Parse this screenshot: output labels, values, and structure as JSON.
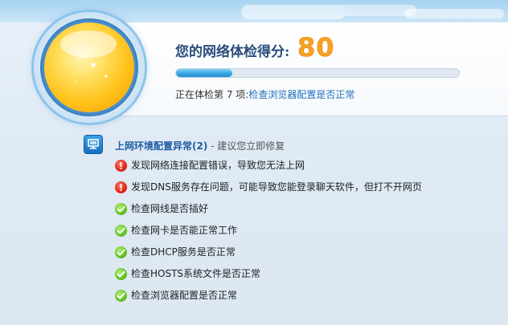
{
  "header": {
    "score_title": "您的网络体检得分:",
    "score_value": "80",
    "progress_percent": 20,
    "status_prefix": "正在体检第 7 项:",
    "status_link": "检查浏览器配置是否正常"
  },
  "section": {
    "icon": "computer-monitor-icon",
    "title": "上网环境配置异常(2)",
    "suggestion": "- 建议您立即修复"
  },
  "items": [
    {
      "status": "error",
      "icon": "error-exclamation-icon",
      "text": "发现网络连接配置错误，导致您无法上网"
    },
    {
      "status": "error",
      "icon": "error-exclamation-icon",
      "text": "发现DNS服务存在问题，可能导致您能登录聊天软件，但打不开网页"
    },
    {
      "status": "ok",
      "icon": "check-icon",
      "text": "检查网线是否插好"
    },
    {
      "status": "ok",
      "icon": "check-icon",
      "text": "检查网卡是否能正常工作"
    },
    {
      "status": "ok",
      "icon": "check-icon",
      "text": "检查DHCP服务是否正常"
    },
    {
      "status": "ok",
      "icon": "check-icon",
      "text": "检查HOSTS系统文件是否正常"
    },
    {
      "status": "ok",
      "icon": "check-icon",
      "text": "检查浏览器配置是否正常"
    }
  ],
  "colors": {
    "score": "#f7a21f",
    "title": "#2a4c7a",
    "link": "#1f6fb9",
    "error": "#e32212",
    "ok": "#62c324"
  }
}
